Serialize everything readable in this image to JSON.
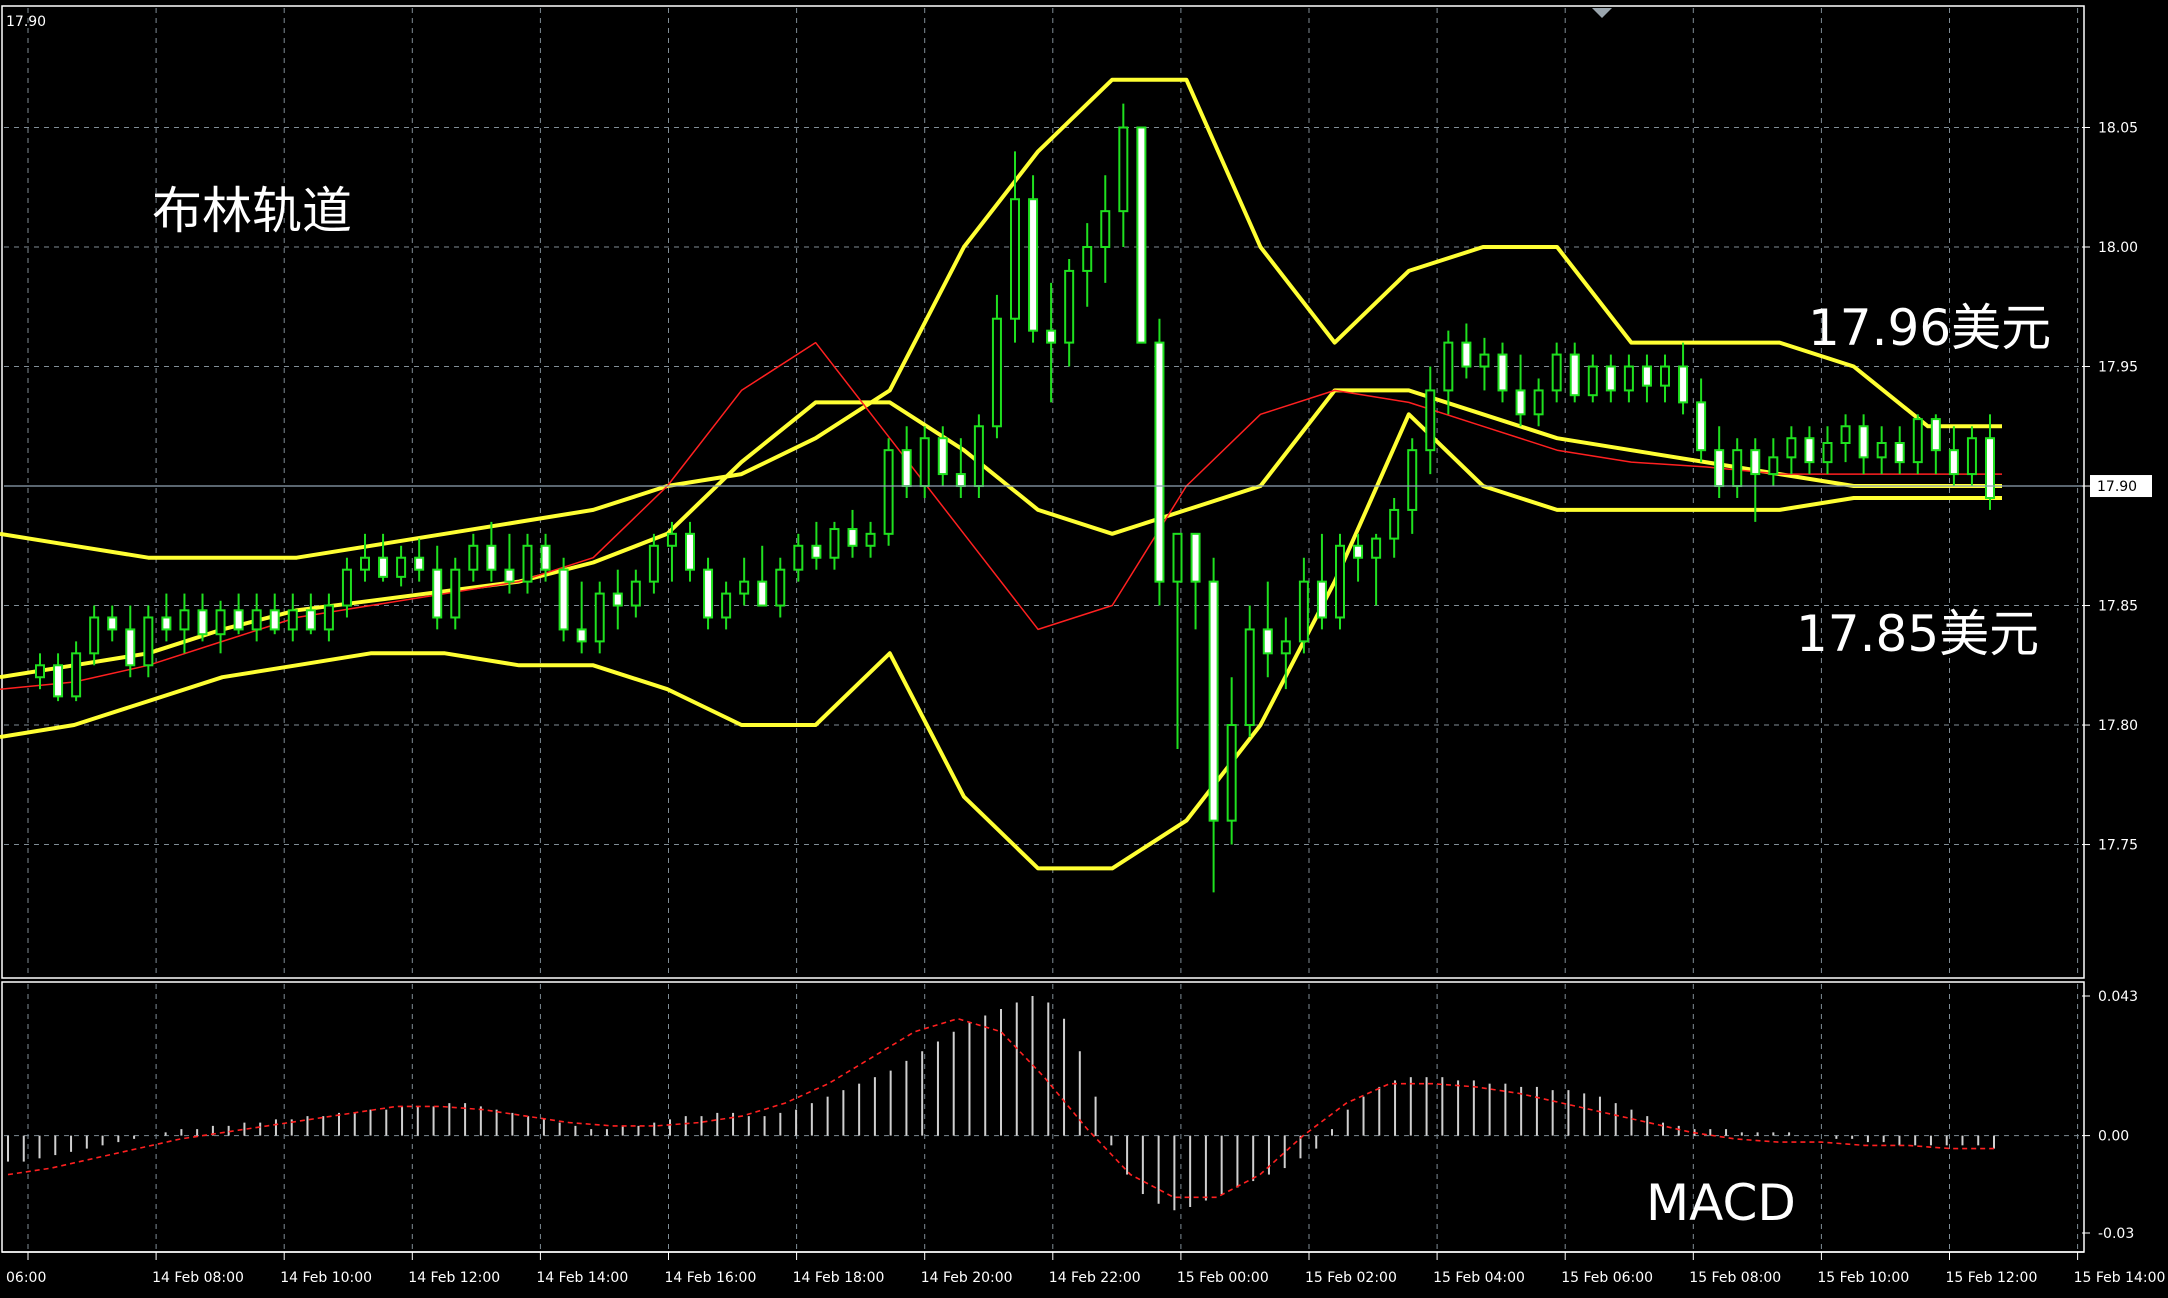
{
  "colors": {
    "background": "#000000",
    "grid": "#7f8c95",
    "axis": "#ffffff",
    "candle": "#1fe01f",
    "bollinger": "#ffff33",
    "ma": "#ff2020",
    "histogram": "#d0d0d0",
    "signal": "#ff2020",
    "price_line": "#8fa3b4"
  },
  "top_left_label": "17.90",
  "annotations": {
    "title": "布林轨道",
    "upper_value": "17.96美元",
    "lower_value": "17.85美元",
    "macd": "MACD"
  },
  "chart_data": [
    {
      "type": "candlestick",
      "title": "布林轨道",
      "y_ticks": [
        "18.05",
        "18.00",
        "17.95",
        "17.90",
        "17.85",
        "17.80",
        "17.75"
      ],
      "ylim": [
        17.695,
        18.1
      ],
      "current_price": "17.90",
      "x_ticks": [
        "06:00",
        "14 Feb 08:00",
        "14 Feb 10:00",
        "14 Feb 12:00",
        "14 Feb 14:00",
        "14 Feb 16:00",
        "14 Feb 18:00",
        "14 Feb 20:00",
        "14 Feb 22:00",
        "15 Feb 00:00",
        "15 Feb 02:00",
        "15 Feb 04:00",
        "15 Feb 06:00",
        "15 Feb 08:00",
        "15 Feb 10:00",
        "15 Feb 12:00",
        "15 Feb 14:00"
      ],
      "candles": [
        [
          17.82,
          17.83,
          17.815,
          17.825
        ],
        [
          17.825,
          17.83,
          17.81,
          17.812
        ],
        [
          17.812,
          17.835,
          17.81,
          17.83
        ],
        [
          17.83,
          17.85,
          17.825,
          17.845
        ],
        [
          17.845,
          17.85,
          17.835,
          17.84
        ],
        [
          17.84,
          17.85,
          17.82,
          17.825
        ],
        [
          17.825,
          17.85,
          17.82,
          17.845
        ],
        [
          17.845,
          17.855,
          17.835,
          17.84
        ],
        [
          17.84,
          17.855,
          17.83,
          17.848
        ],
        [
          17.848,
          17.855,
          17.835,
          17.838
        ],
        [
          17.838,
          17.852,
          17.83,
          17.848
        ],
        [
          17.848,
          17.855,
          17.838,
          17.84
        ],
        [
          17.84,
          17.855,
          17.835,
          17.848
        ],
        [
          17.848,
          17.855,
          17.838,
          17.84
        ],
        [
          17.84,
          17.855,
          17.835,
          17.848
        ],
        [
          17.848,
          17.855,
          17.838,
          17.84
        ],
        [
          17.84,
          17.855,
          17.835,
          17.85
        ],
        [
          17.85,
          17.87,
          17.845,
          17.865
        ],
        [
          17.865,
          17.88,
          17.86,
          17.87
        ],
        [
          17.87,
          17.88,
          17.86,
          17.862
        ],
        [
          17.862,
          17.875,
          17.858,
          17.87
        ],
        [
          17.87,
          17.878,
          17.86,
          17.865
        ],
        [
          17.865,
          17.875,
          17.84,
          17.845
        ],
        [
          17.845,
          17.87,
          17.84,
          17.865
        ],
        [
          17.865,
          17.88,
          17.86,
          17.875
        ],
        [
          17.875,
          17.885,
          17.86,
          17.865
        ],
        [
          17.865,
          17.88,
          17.855,
          17.86
        ],
        [
          17.86,
          17.88,
          17.855,
          17.875
        ],
        [
          17.875,
          17.88,
          17.86,
          17.865
        ],
        [
          17.865,
          17.87,
          17.835,
          17.84
        ],
        [
          17.84,
          17.86,
          17.83,
          17.835
        ],
        [
          17.835,
          17.86,
          17.83,
          17.855
        ],
        [
          17.855,
          17.865,
          17.84,
          17.85
        ],
        [
          17.85,
          17.865,
          17.845,
          17.86
        ],
        [
          17.86,
          17.88,
          17.855,
          17.875
        ],
        [
          17.875,
          17.885,
          17.86,
          17.88
        ],
        [
          17.88,
          17.885,
          17.86,
          17.865
        ],
        [
          17.865,
          17.87,
          17.84,
          17.845
        ],
        [
          17.845,
          17.86,
          17.84,
          17.855
        ],
        [
          17.855,
          17.87,
          17.85,
          17.86
        ],
        [
          17.86,
          17.875,
          17.85,
          17.85
        ],
        [
          17.85,
          17.87,
          17.845,
          17.865
        ],
        [
          17.865,
          17.88,
          17.86,
          17.875
        ],
        [
          17.875,
          17.885,
          17.865,
          17.87
        ],
        [
          17.87,
          17.885,
          17.865,
          17.882
        ],
        [
          17.882,
          17.89,
          17.87,
          17.875
        ],
        [
          17.875,
          17.885,
          17.87,
          17.88
        ],
        [
          17.88,
          17.92,
          17.875,
          17.915
        ],
        [
          17.915,
          17.925,
          17.895,
          17.9
        ],
        [
          17.9,
          17.925,
          17.895,
          17.92
        ],
        [
          17.92,
          17.925,
          17.9,
          17.905
        ],
        [
          17.905,
          17.92,
          17.895,
          17.9
        ],
        [
          17.9,
          17.93,
          17.895,
          17.925
        ],
        [
          17.925,
          17.98,
          17.92,
          17.97
        ],
        [
          17.97,
          18.04,
          17.96,
          18.02
        ],
        [
          18.02,
          18.03,
          17.96,
          17.965
        ],
        [
          17.965,
          17.985,
          17.935,
          17.96
        ],
        [
          17.96,
          17.995,
          17.95,
          17.99
        ],
        [
          17.99,
          18.01,
          17.975,
          18.0
        ],
        [
          18.0,
          18.03,
          17.985,
          18.015
        ],
        [
          18.015,
          18.06,
          18.0,
          18.05
        ],
        [
          18.05,
          18.05,
          17.96,
          17.96
        ],
        [
          17.96,
          17.97,
          17.85,
          17.86
        ],
        [
          17.86,
          17.88,
          17.79,
          17.88
        ],
        [
          17.88,
          17.88,
          17.84,
          17.86
        ],
        [
          17.86,
          17.87,
          17.73,
          17.76
        ],
        [
          17.76,
          17.82,
          17.75,
          17.8
        ],
        [
          17.8,
          17.85,
          17.795,
          17.84
        ],
        [
          17.84,
          17.86,
          17.82,
          17.83
        ],
        [
          17.83,
          17.845,
          17.815,
          17.835
        ],
        [
          17.835,
          17.87,
          17.83,
          17.86
        ],
        [
          17.86,
          17.88,
          17.84,
          17.845
        ],
        [
          17.845,
          17.88,
          17.84,
          17.875
        ],
        [
          17.875,
          17.88,
          17.86,
          17.87
        ],
        [
          17.87,
          17.88,
          17.85,
          17.878
        ],
        [
          17.878,
          17.895,
          17.87,
          17.89
        ],
        [
          17.89,
          17.92,
          17.88,
          17.915
        ],
        [
          17.915,
          17.95,
          17.905,
          17.94
        ],
        [
          17.94,
          17.965,
          17.93,
          17.96
        ],
        [
          17.96,
          17.968,
          17.945,
          17.95
        ],
        [
          17.95,
          17.962,
          17.94,
          17.955
        ],
        [
          17.955,
          17.96,
          17.935,
          17.94
        ],
        [
          17.94,
          17.955,
          17.925,
          17.93
        ],
        [
          17.93,
          17.945,
          17.925,
          17.94
        ],
        [
          17.94,
          17.96,
          17.935,
          17.955
        ],
        [
          17.955,
          17.96,
          17.935,
          17.938
        ],
        [
          17.938,
          17.955,
          17.935,
          17.95
        ],
        [
          17.95,
          17.955,
          17.935,
          17.94
        ],
        [
          17.94,
          17.955,
          17.935,
          17.95
        ],
        [
          17.95,
          17.955,
          17.935,
          17.942
        ],
        [
          17.942,
          17.955,
          17.935,
          17.95
        ],
        [
          17.95,
          17.96,
          17.93,
          17.935
        ],
        [
          17.935,
          17.945,
          17.91,
          17.915
        ],
        [
          17.915,
          17.925,
          17.895,
          17.9
        ],
        [
          17.9,
          17.92,
          17.895,
          17.915
        ],
        [
          17.915,
          17.92,
          17.885,
          17.905
        ],
        [
          17.905,
          17.92,
          17.9,
          17.912
        ],
        [
          17.912,
          17.925,
          17.905,
          17.92
        ],
        [
          17.92,
          17.925,
          17.905,
          17.91
        ],
        [
          17.91,
          17.925,
          17.905,
          17.918
        ],
        [
          17.918,
          17.93,
          17.91,
          17.925
        ],
        [
          17.925,
          17.93,
          17.905,
          17.912
        ],
        [
          17.912,
          17.925,
          17.905,
          17.918
        ],
        [
          17.918,
          17.925,
          17.905,
          17.91
        ],
        [
          17.91,
          17.93,
          17.905,
          17.928
        ],
        [
          17.928,
          17.93,
          17.905,
          17.915
        ],
        [
          17.915,
          17.925,
          17.9,
          17.905
        ],
        [
          17.905,
          17.925,
          17.9,
          17.92
        ],
        [
          17.92,
          17.93,
          17.89,
          17.895
        ]
      ],
      "bollinger_upper": [
        17.88,
        17.875,
        17.87,
        17.87,
        17.87,
        17.875,
        17.88,
        17.885,
        17.89,
        17.9,
        17.905,
        17.92,
        17.94,
        18.0,
        18.04,
        18.07,
        18.07,
        18.0,
        17.96,
        17.99,
        18.0,
        18.0,
        17.96,
        17.96,
        17.96,
        17.95,
        17.925,
        17.925
      ],
      "bollinger_mid": [
        17.82,
        17.825,
        17.83,
        17.84,
        17.848,
        17.852,
        17.856,
        17.86,
        17.868,
        17.88,
        17.91,
        17.935,
        17.935,
        17.915,
        17.89,
        17.88,
        17.89,
        17.9,
        17.94,
        17.94,
        17.93,
        17.92,
        17.915,
        17.91,
        17.905,
        17.9,
        17.9,
        17.9
      ],
      "bollinger_lower": [
        17.795,
        17.8,
        17.81,
        17.82,
        17.825,
        17.83,
        17.83,
        17.825,
        17.825,
        17.815,
        17.8,
        17.8,
        17.83,
        17.77,
        17.74,
        17.74,
        17.76,
        17.8,
        17.86,
        17.93,
        17.9,
        17.89,
        17.89,
        17.89,
        17.89,
        17.895,
        17.895,
        17.895
      ],
      "moving_average": [
        17.815,
        17.818,
        17.825,
        17.835,
        17.845,
        17.85,
        17.855,
        17.86,
        17.87,
        17.9,
        17.94,
        17.96,
        17.92,
        17.88,
        17.84,
        17.85,
        17.9,
        17.93,
        17.94,
        17.935,
        17.925,
        17.915,
        17.91,
        17.908,
        17.905,
        17.905,
        17.905,
        17.905
      ]
    },
    {
      "type": "bar",
      "title": "MACD",
      "y_ticks": [
        "0.043",
        "0.00",
        "-0.03"
      ],
      "ylim": [
        -0.034,
        0.043
      ],
      "histogram": [
        -0.008,
        -0.008,
        -0.007,
        -0.006,
        -0.005,
        -0.004,
        -0.003,
        -0.002,
        -0.001,
        0.0,
        0.001,
        0.002,
        0.002,
        0.003,
        0.003,
        0.004,
        0.004,
        0.005,
        0.005,
        0.006,
        0.006,
        0.007,
        0.007,
        0.008,
        0.008,
        0.009,
        0.009,
        0.009,
        0.01,
        0.01,
        0.009,
        0.008,
        0.007,
        0.006,
        0.005,
        0.004,
        0.003,
        0.002,
        0.002,
        0.003,
        0.003,
        0.004,
        0.005,
        0.006,
        0.006,
        0.007,
        0.007,
        0.006,
        0.006,
        0.007,
        0.008,
        0.01,
        0.012,
        0.014,
        0.016,
        0.018,
        0.02,
        0.023,
        0.026,
        0.029,
        0.032,
        0.035,
        0.037,
        0.039,
        0.041,
        0.043,
        0.041,
        0.036,
        0.026,
        0.012,
        -0.003,
        -0.012,
        -0.018,
        -0.021,
        -0.023,
        -0.022,
        -0.02,
        -0.018,
        -0.016,
        -0.014,
        -0.012,
        -0.01,
        -0.007,
        -0.004,
        0.002,
        0.008,
        0.012,
        0.015,
        0.017,
        0.018,
        0.018,
        0.018,
        0.017,
        0.017,
        0.016,
        0.016,
        0.015,
        0.015,
        0.014,
        0.014,
        0.013,
        0.012,
        0.01,
        0.008,
        0.006,
        0.004,
        0.003,
        0.002,
        0.002,
        0.002,
        0.001,
        0.001,
        0.001,
        0.001,
        0.0,
        0.0,
        -0.001,
        -0.001,
        -0.002,
        -0.002,
        -0.003,
        -0.003,
        -0.003,
        -0.003,
        -0.003,
        -0.003,
        -0.004
      ],
      "signal": [
        -0.012,
        -0.01,
        -0.007,
        -0.004,
        -0.001,
        0.001,
        0.003,
        0.005,
        0.007,
        0.009,
        0.009,
        0.008,
        0.006,
        0.004,
        0.003,
        0.003,
        0.004,
        0.006,
        0.01,
        0.016,
        0.024,
        0.032,
        0.036,
        0.032,
        0.018,
        0.002,
        -0.012,
        -0.019,
        -0.019,
        -0.012,
        0.0,
        0.01,
        0.016,
        0.016,
        0.015,
        0.013,
        0.01,
        0.007,
        0.004,
        0.001,
        -0.001,
        -0.002,
        -0.002,
        -0.003,
        -0.003,
        -0.004,
        -0.004
      ]
    }
  ]
}
